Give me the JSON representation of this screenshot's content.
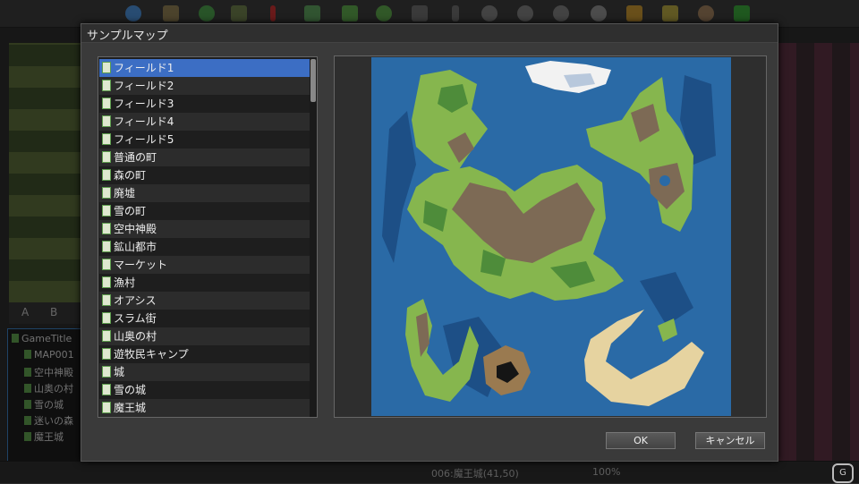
{
  "dialog": {
    "title": "サンプルマップ",
    "ok_label": "OK",
    "cancel_label": "キャンセル"
  },
  "map_list": {
    "items": [
      {
        "label": "フィールド1",
        "selected": true
      },
      {
        "label": "フィールド2"
      },
      {
        "label": "フィールド3"
      },
      {
        "label": "フィールド4"
      },
      {
        "label": "フィールド5"
      },
      {
        "label": "普通の町"
      },
      {
        "label": "森の町"
      },
      {
        "label": "廃墟"
      },
      {
        "label": "雪の町"
      },
      {
        "label": "空中神殿"
      },
      {
        "label": "鉱山都市"
      },
      {
        "label": "マーケット"
      },
      {
        "label": "漁村"
      },
      {
        "label": "オアシス"
      },
      {
        "label": "スラム街"
      },
      {
        "label": "山奥の村"
      },
      {
        "label": "遊牧民キャンプ"
      },
      {
        "label": "城"
      },
      {
        "label": "雪の城"
      },
      {
        "label": "魔王城"
      }
    ]
  },
  "editor": {
    "palette_tabs": [
      "A",
      "B"
    ],
    "tree": {
      "root": "GameTitle",
      "items": [
        "MAP001",
        "空中神殿",
        "山奥の村",
        "雪の城",
        "迷いの森",
        "魔王城"
      ]
    },
    "status": {
      "location": "006:魔王城(41,50)",
      "zoom": "100%"
    }
  },
  "colors": {
    "ocean": "#2a6aa6",
    "deep_ocean": "#1d4f86",
    "grass": "#86b64e",
    "forest": "#4e8c3a",
    "mountain": "#7d6a55",
    "sand": "#e6d3a0",
    "snow": "#f2f2f2",
    "selection": "#3c6ec4"
  }
}
